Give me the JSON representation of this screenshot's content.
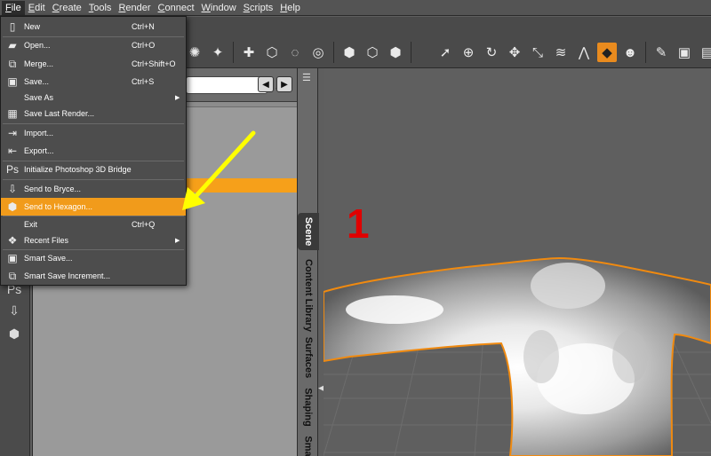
{
  "menubar": {
    "items": [
      "File",
      "Edit",
      "Create",
      "Tools",
      "Render",
      "Connect",
      "Window",
      "Scripts",
      "Help"
    ]
  },
  "file_menu": {
    "items": [
      {
        "label": "New",
        "shortcut": "Ctrl+N",
        "icon": "page-icon"
      },
      {
        "label": "Open...",
        "shortcut": "Ctrl+O",
        "icon": "folder-icon"
      },
      {
        "label": "Merge...",
        "shortcut": "Ctrl+Shift+O",
        "icon": "merge-icon"
      },
      {
        "label": "Save...",
        "shortcut": "Ctrl+S",
        "icon": "floppy-icon"
      },
      {
        "label": "Save As",
        "shortcut": "",
        "icon": ""
      },
      {
        "label": "Save Last Render...",
        "shortcut": "",
        "icon": "render-save-icon"
      },
      {
        "label": "Import...",
        "shortcut": "",
        "icon": "import-icon"
      },
      {
        "label": "Export...",
        "shortcut": "",
        "icon": "export-icon"
      },
      {
        "label": "Initialize Photoshop 3D Bridge",
        "shortcut": "",
        "icon": "photoshop-icon"
      },
      {
        "label": "Send to Bryce...",
        "shortcut": "",
        "icon": "bryce-icon"
      },
      {
        "label": "Send to Hexagon...",
        "shortcut": "",
        "icon": "hexagon-icon"
      },
      {
        "label": "Exit",
        "shortcut": "Ctrl+Q",
        "icon": ""
      },
      {
        "label": "Recent Files",
        "shortcut": "",
        "icon": "recent-files-icon"
      },
      {
        "label": "Smart Save...",
        "shortcut": "",
        "icon": "smart-save-icon"
      },
      {
        "label": "Smart Save Increment...",
        "shortcut": "",
        "icon": "smart-save-increment-icon"
      }
    ]
  },
  "side_tabs": [
    "Scene",
    "Content Library",
    "Surfaces",
    "Shaping",
    "Sma"
  ],
  "viewport": {
    "annotation_number": "1"
  },
  "colors": {
    "highlight": "#f19b1b",
    "annotation_arrow": "#ffff00",
    "annotation_number": "#e00000",
    "selection_outline": "#f08a10"
  }
}
